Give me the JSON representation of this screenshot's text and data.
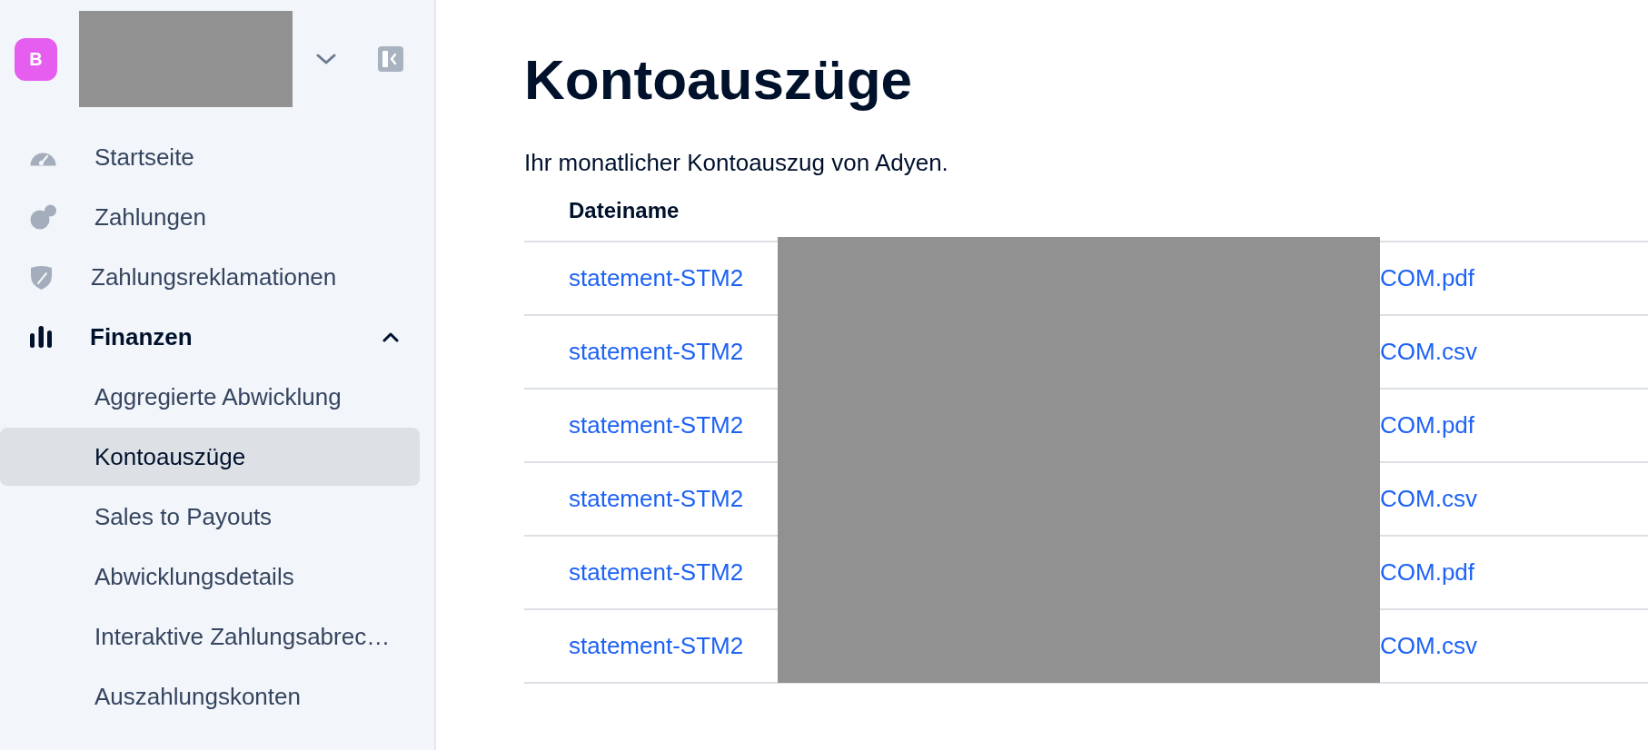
{
  "account": {
    "initial": "B",
    "name_redacted": true
  },
  "sidebar": {
    "items": [
      {
        "label": "Startseite",
        "active": false
      },
      {
        "label": "Zahlungen",
        "active": false
      },
      {
        "label": "Zahlungsreklamationen",
        "active": false
      },
      {
        "label": "Finanzen",
        "active": true,
        "expanded": true,
        "children": [
          {
            "label": "Aggregierte Abwicklung",
            "selected": false
          },
          {
            "label": "Kontoauszüge",
            "selected": true
          },
          {
            "label": "Sales to Payouts",
            "selected": false
          },
          {
            "label": "Abwicklungsdetails",
            "selected": false
          },
          {
            "label": "Interaktive Zahlungsabrec…",
            "selected": false
          },
          {
            "label": "Auszahlungskonten",
            "selected": false
          }
        ]
      }
    ]
  },
  "page": {
    "title": "Kontoauszüge",
    "description": "Ihr monatlicher Kontoauszug von Adyen."
  },
  "table": {
    "columns": [
      "Dateiname"
    ],
    "redacted": true,
    "rows": [
      {
        "file_name_start": "statement-STM2",
        "file_name_end": "COM.pdf"
      },
      {
        "file_name_start": "statement-STM2",
        "file_name_end": "COM.csv"
      },
      {
        "file_name_start": "statement-STM2",
        "file_name_end": "COM.pdf"
      },
      {
        "file_name_start": "statement-STM2",
        "file_name_end": "COM.csv"
      },
      {
        "file_name_start": "statement-STM2",
        "file_name_end": "COM.pdf"
      },
      {
        "file_name_start": "statement-STM2",
        "file_name_end": "COM.csv"
      }
    ]
  }
}
